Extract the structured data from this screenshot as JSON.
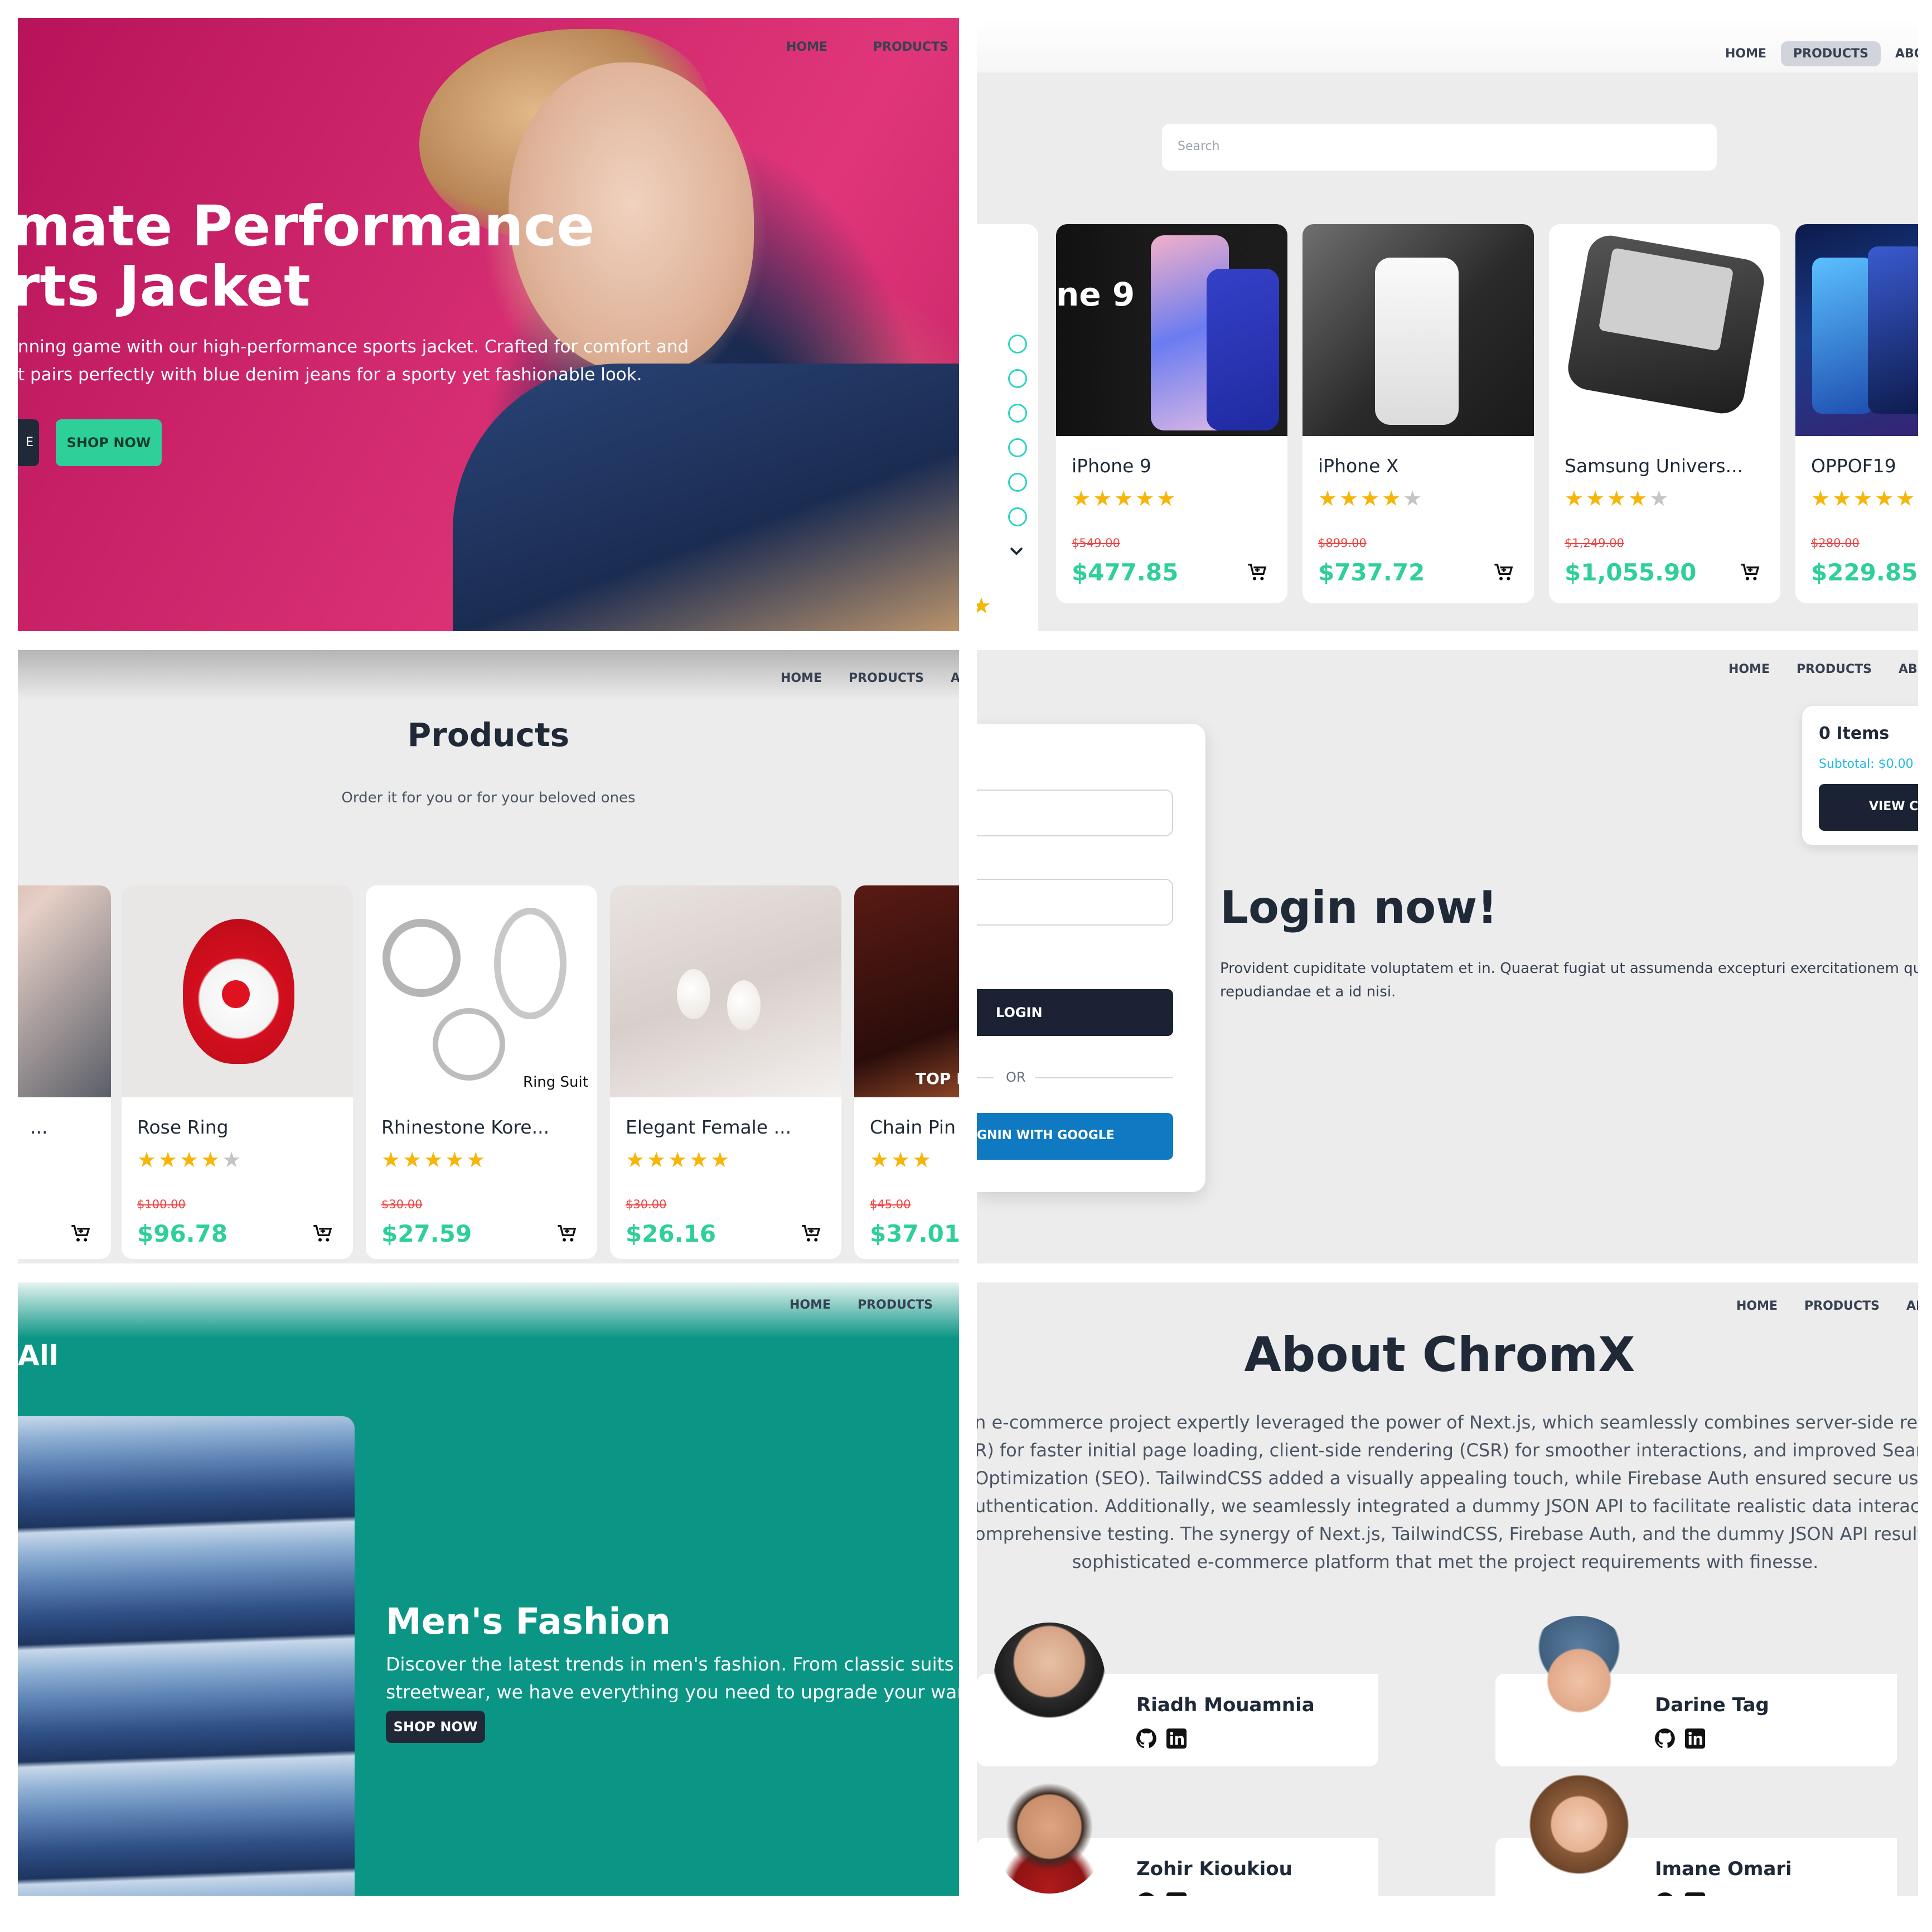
{
  "nav": {
    "home": "HOME",
    "products": "PRODUCTS",
    "about": "ABOUT"
  },
  "hero": {
    "headline_line1": "mate Performance",
    "headline_line2": "rts Jacket",
    "desc_line1": "nning game with our high-performance sports jacket. Crafted for comfort and",
    "desc_line2": "t pairs perfectly with blue denim jeans for a sporty yet fashionable look.",
    "button_partial": "E",
    "shop_now": "SHOP NOW"
  },
  "catalog": {
    "search_placeholder": "Search",
    "products": [
      {
        "title": "iPhone 9",
        "rating": 5,
        "old_price": "$549.00",
        "price": "$477.85",
        "img_text": "ne 9"
      },
      {
        "title": "iPhone X",
        "rating": 4.5,
        "old_price": "$899.00",
        "price": "$737.72"
      },
      {
        "title": "Samsung Univers...",
        "rating": 4,
        "old_price": "$1,249.00",
        "price": "$1,055.90"
      },
      {
        "title": "OPPOF19",
        "rating": 4.5,
        "old_price": "$280.00",
        "price": "$229.85"
      }
    ]
  },
  "products_page": {
    "title": "Products",
    "subtitle": "Order it for you or for your beloved ones",
    "items": [
      {
        "title": "...",
        "rating": 0,
        "old_price": "",
        "price": ""
      },
      {
        "title": "Rose Ring",
        "rating": 4,
        "old_price": "$100.00",
        "price": "$96.78"
      },
      {
        "title": "Rhinestone Kore...",
        "rating": 5,
        "old_price": "$30.00",
        "price": "$27.59",
        "img_text": "Ring Suit"
      },
      {
        "title": "Elegant Female ...",
        "rating": 5,
        "old_price": "$30.00",
        "price": "$26.16"
      },
      {
        "title": "Chain Pin T",
        "rating": 3,
        "old_price": "$45.00",
        "price": "$37.01",
        "img_text": "TOP R"
      }
    ]
  },
  "login": {
    "login_button": "LOGIN",
    "or": "OR",
    "google_button": "GNIN WITH GOOGLE",
    "title": "Login now!",
    "desc_line1": "Provident cupiditate voluptatem et in. Quaerat fugiat ut assumenda excepturi exercitationem quasi. In",
    "desc_line2": "repudiandae et a id nisi.",
    "cart_items": "0 Items",
    "cart_subtotal": "Subtotal: $0.00",
    "view_cart": "VIEW C"
  },
  "fashion": {
    "tab": "All",
    "title": "Men's Fashion",
    "desc_line1": "Discover the latest trends in men's fashion. From classic suits to ca",
    "desc_line2": "streetwear, we have everything you need to upgrade your wardrob",
    "shop_now": "SHOP NOW"
  },
  "about": {
    "title": "About ChromX",
    "lines": [
      "n e-commerce project expertly leveraged the power of Next.js, which seamlessly combines server-side rendering",
      "R) for faster initial page loading, client-side rendering (CSR) for smoother interactions, and improved Search Engin",
      "Optimization (SEO). TailwindCSS added a visually appealing touch, while Firebase Auth ensured secure user",
      "uthentication. Additionally, we seamlessly integrated a dummy JSON API to facilitate realistic data interactions for",
      "omprehensive testing. The synergy of Next.js, TailwindCSS, Firebase Auth, and the dummy JSON API resulted in a",
      "sophisticated e-commerce platform that met the project requirements with finesse."
    ],
    "team": [
      {
        "name": "Riadh Mouamnia"
      },
      {
        "name": "Darine Tag"
      },
      {
        "name": "Zohir Kioukiou"
      },
      {
        "name": "Imane Omari"
      }
    ]
  },
  "colors": {
    "accent_green": "#2fcf9a",
    "teal": "#0b9585",
    "navy": "#1a2233",
    "star": "#f5b50a",
    "google_blue": "#0f7ac1",
    "hero_pink": "#d22a6f"
  },
  "icons": [
    "cart-icon",
    "github-icon",
    "linkedin-icon",
    "chevron-down-icon",
    "star-icon"
  ]
}
